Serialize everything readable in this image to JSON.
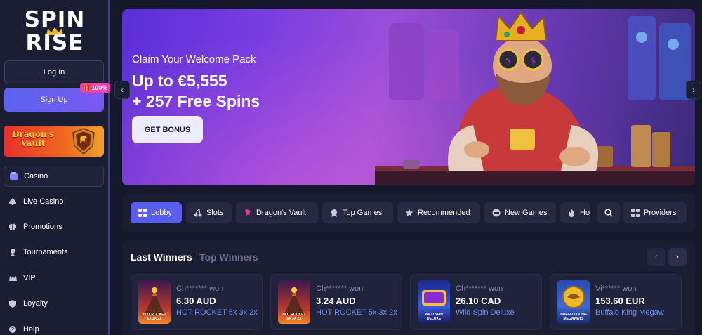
{
  "brand": {
    "logo_line1": "SPIN",
    "logo_line2": "RISE"
  },
  "sidebar": {
    "login_label": "Log In",
    "signup_label": "Sign Up",
    "signup_badge": "100%",
    "promo_label": "Dragon's Vault",
    "items": [
      {
        "label": "Casino",
        "icon": "casino-icon"
      },
      {
        "label": "Live Casino",
        "icon": "spade-icon"
      },
      {
        "label": "Promotions",
        "icon": "gift-icon"
      },
      {
        "label": "Tournaments",
        "icon": "trophy-icon"
      },
      {
        "label": "VIP",
        "icon": "crown-icon"
      },
      {
        "label": "Loyalty",
        "icon": "shield-icon"
      },
      {
        "label": "Help",
        "icon": "help-icon"
      }
    ]
  },
  "hero": {
    "subtitle": "Claim Your Welcome Pack",
    "title_line1": "Up to €5,555",
    "title_line2": "+ 257 Free Spins",
    "button_label": "GET BONUS"
  },
  "categories": [
    {
      "label": "Lobby",
      "icon": "grid-icon",
      "active": true
    },
    {
      "label": "Slots",
      "icon": "cherry-icon"
    },
    {
      "label": "Dragon's Vault",
      "icon": "dragon-icon"
    },
    {
      "label": "Top Games",
      "icon": "medal-icon"
    },
    {
      "label": "Recommended",
      "icon": "star-icon"
    },
    {
      "label": "New Games",
      "icon": "new-icon"
    },
    {
      "label": "Ho",
      "icon": "fire-icon"
    },
    {
      "label": "Providers",
      "icon": "grid-icon"
    }
  ],
  "winners": {
    "tab_last": "Last Winners",
    "tab_top": "Top Winners",
    "items": [
      {
        "who": "Ch******* won",
        "amount": "6.30 AUD",
        "game": "HOT ROCKET 5x 3x 2x",
        "thumb_text": "HOT ROCKET\n5X 3X 2X"
      },
      {
        "who": "Ch******* won",
        "amount": "3.24 AUD",
        "game": "HOT ROCKET 5x 3x 2x",
        "thumb_text": "HOT ROCKET\n5X 3X 2X"
      },
      {
        "who": "Ch******* won",
        "amount": "26.10 CAD",
        "game": "Wild Spin Deluxe",
        "thumb_text": "WILD SPIN\nDELUXE"
      },
      {
        "who": "Vi****** won",
        "amount": "153.60 EUR",
        "game": "Buffalo King Megaw",
        "thumb_text": "BUFFALO KING\nMEGAWAYS"
      }
    ]
  },
  "colors": {
    "background": "#15172b",
    "panel": "#1b1d33",
    "accent": "#5a5ef0",
    "link": "#6b8cf5",
    "badge": "#ee3fb0"
  }
}
